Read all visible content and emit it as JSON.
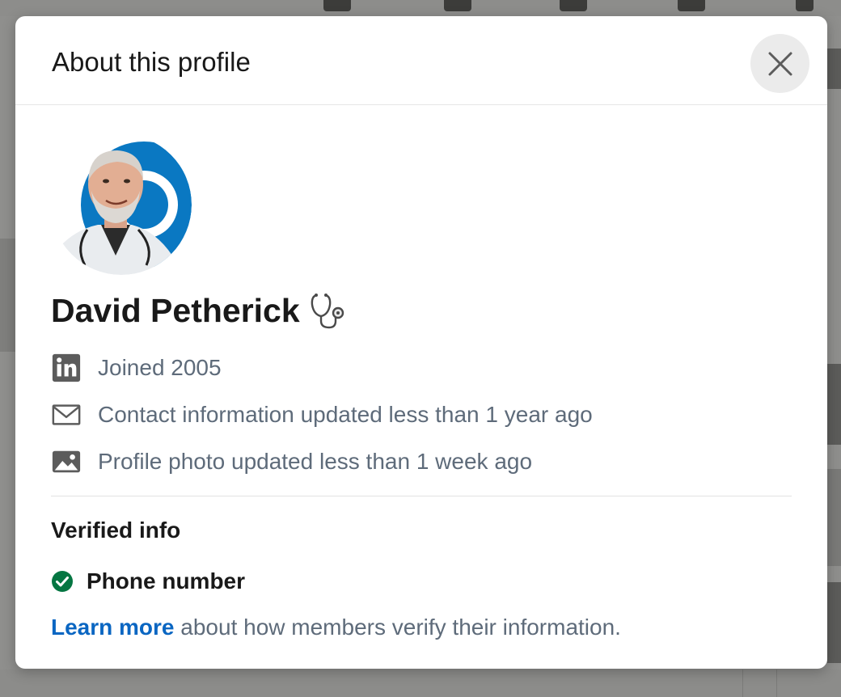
{
  "modal": {
    "title": "About this profile",
    "close_icon": "close-icon"
  },
  "profile": {
    "name": "David Petherick",
    "name_badge_icon": "stethoscope-icon"
  },
  "details": [
    {
      "icon": "linkedin-icon",
      "text": "Joined 2005"
    },
    {
      "icon": "envelope-icon",
      "text": "Contact information updated less than 1 year ago"
    },
    {
      "icon": "image-icon",
      "text": "Profile photo updated less than 1 week ago"
    }
  ],
  "verified": {
    "heading": "Verified info",
    "items": [
      {
        "icon": "checkmark-circle-icon",
        "label": "Phone number"
      }
    ]
  },
  "footer": {
    "link_text": "Learn more",
    "text": " about how members verify their information."
  },
  "colors": {
    "link": "#0a66c2",
    "verified_green": "#057642",
    "secondary_text": "#5e6b7a",
    "avatar_ring": "#0a78c2"
  }
}
